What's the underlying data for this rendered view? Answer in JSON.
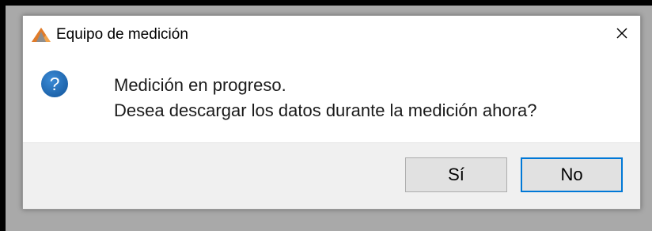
{
  "dialog": {
    "title": "Equipo de medición",
    "app_icon": "triangle-logo-icon",
    "close_icon": "close-icon",
    "message_icon": "question-icon",
    "message_lines": [
      "Medición en progreso.",
      "Desea descargar los datos durante la medición ahora?"
    ],
    "buttons": {
      "yes_label": "Sí",
      "no_label": "No",
      "default": "No"
    }
  },
  "colors": {
    "accent": "#0078d7",
    "question_icon": "#1f6fb5",
    "button_bg": "#e1e1e1",
    "footer_bg": "#f0f0f0"
  }
}
